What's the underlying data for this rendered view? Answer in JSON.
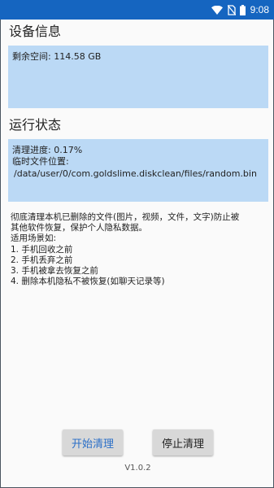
{
  "status_bar": {
    "time": "9:08",
    "background_color": "#1565c0",
    "icons": [
      "wifi-icon",
      "no-sim-icon",
      "battery-icon"
    ]
  },
  "device_info": {
    "title": "设备信息",
    "free_space": "剩余空间: 114.58 GB",
    "box_color": "#bbd9f5"
  },
  "run_status": {
    "title": "运行状态",
    "progress": "清理进度: 0.17%",
    "temp_file_label": "临时文件位置:",
    "temp_file_path": "/data/user/0/com.goldslime.diskclean/files/random.bin"
  },
  "description": {
    "lines": [
      "彻底清理本机已删除的文件(图片，视频，文件，文字)防止被",
      "其他软件恢复，保护个人隐私数据。",
      "适用场景如:",
      "1. 手机回收之前",
      "2. 手机丢弃之前",
      "3. 手机被拿去恢复之前",
      "4. 删除本机隐私不被恢复(如聊天记录等)"
    ]
  },
  "buttons": {
    "start_label": "开始清理",
    "stop_label": "停止清理",
    "start_color": "#2b6fc7"
  },
  "version": "V1.0.2"
}
